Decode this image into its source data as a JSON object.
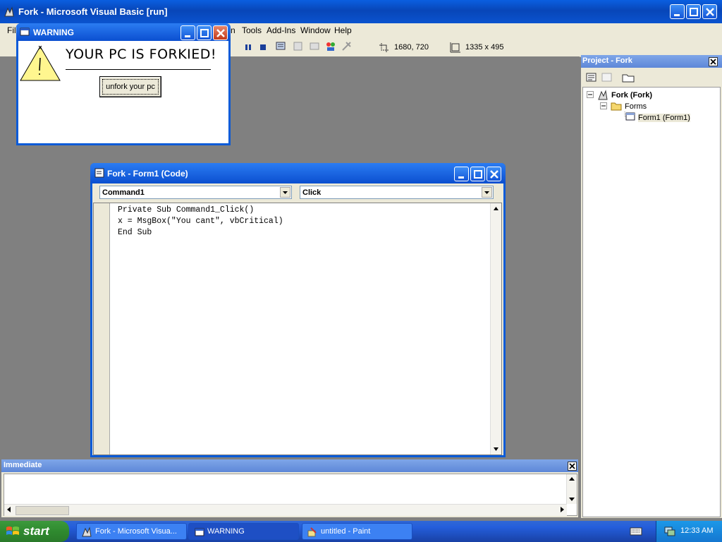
{
  "main_window": {
    "title": "Fork - Microsoft Visual Basic [run]"
  },
  "menu": {
    "file_partial": "Fil",
    "run_partial": "n",
    "items": [
      "Tools",
      "Add-Ins",
      "Window",
      "Help"
    ]
  },
  "toolbar": {
    "position": "1680, 720",
    "size": "1335 x 495"
  },
  "warning_window": {
    "title": "WARNING",
    "message": "YOUR PC IS FORKIED!",
    "button_label": "unfork your pc"
  },
  "code_window": {
    "title": "Fork - Form1 (Code)",
    "object_combo": "Command1",
    "procedure_combo": "Click",
    "code_lines": [
      "Private Sub Command1_Click()",
      "x = MsgBox(\"You cant\", vbCritical)",
      "End Sub"
    ]
  },
  "immediate": {
    "title": "Immediate"
  },
  "project": {
    "title": "Project - Fork",
    "root": "Fork (Fork)",
    "folder": "Forms",
    "item": "Form1 (Form1)"
  },
  "taskbar": {
    "start_label": "start",
    "tasks": [
      "Fork - Microsoft Visua...",
      "WARNING",
      "untitled - Paint"
    ],
    "clock": "12:33 AM"
  },
  "colors": {
    "titlebar": "#0a53cf",
    "desktop_gray": "#808080",
    "face": "#ece9d8",
    "start_green": "#2f8a2f",
    "warning_yellow": "#fff68f"
  }
}
